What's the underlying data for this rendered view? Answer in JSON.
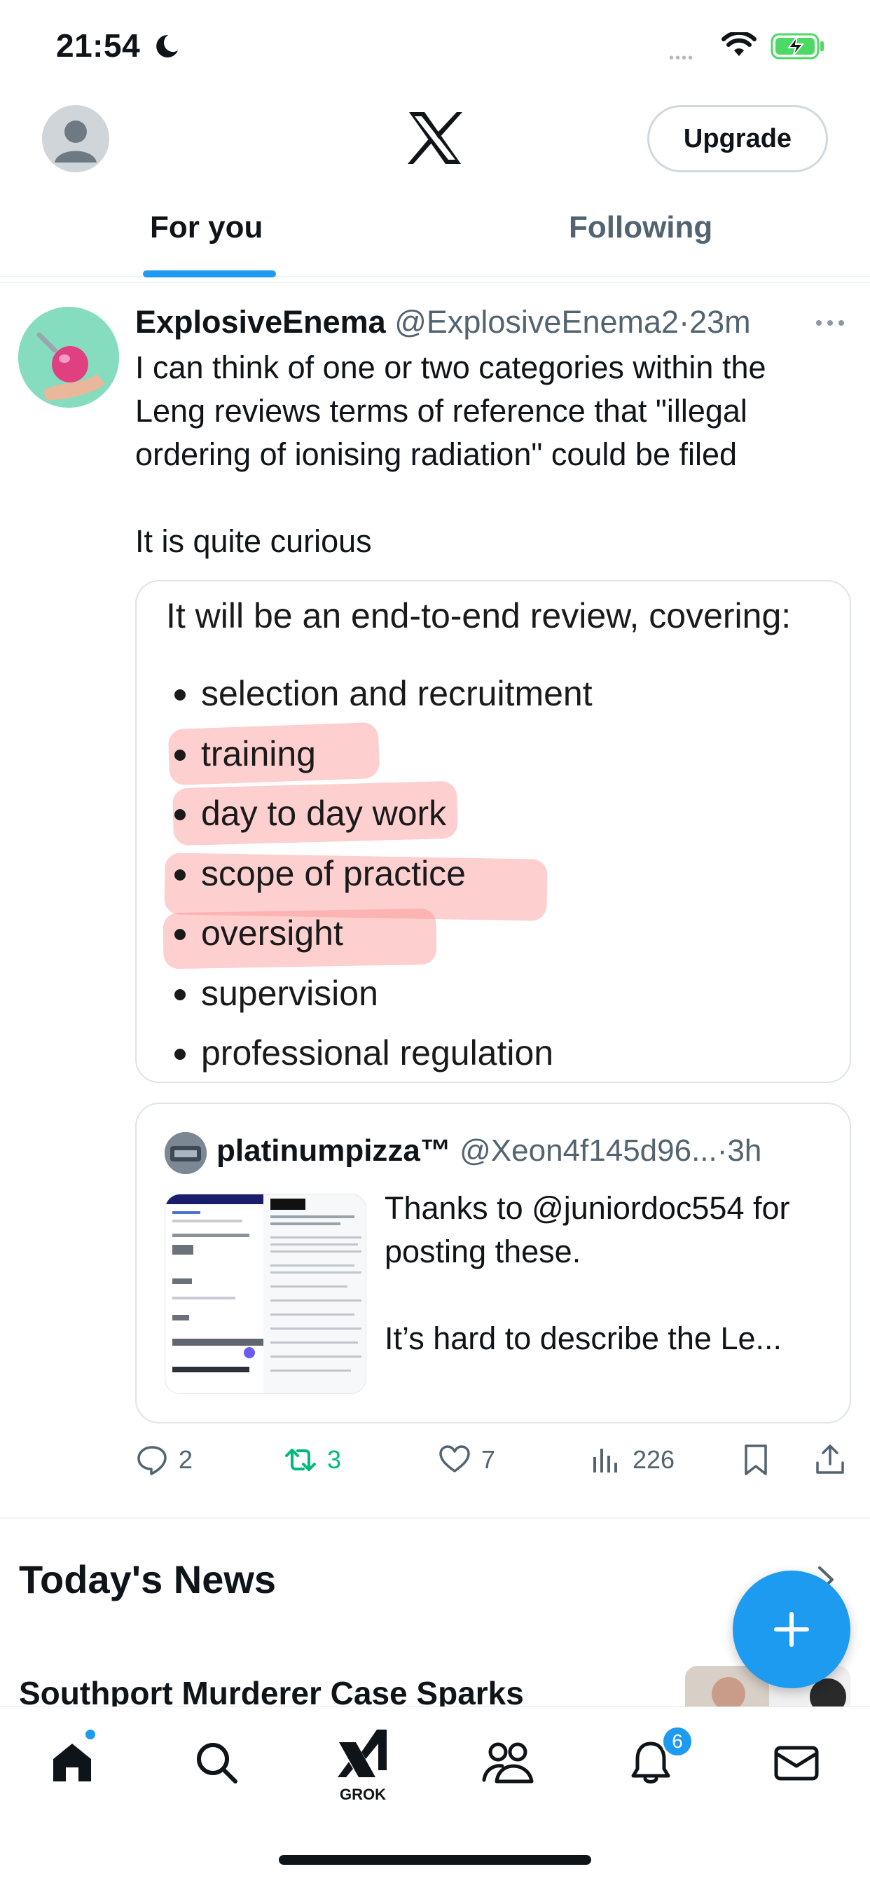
{
  "status_bar": {
    "time": "21:54",
    "signal": "•••• "
  },
  "header": {
    "upgrade_label": "Upgrade"
  },
  "tabs": [
    {
      "label": "For you",
      "selected": true
    },
    {
      "label": "Following",
      "selected": false
    }
  ],
  "tweet": {
    "author_name": "ExplosiveEnema",
    "author_handle": "@ExplosiveEnema2",
    "separator": "·",
    "time": "23m",
    "text": "I can think of one or two categories within the Leng reviews terms of reference that \"illegal ordering of ionising radiation\" could be filed\n\nIt is quite curious",
    "media": {
      "intro": "It will be an end-to-end review, covering:",
      "items": [
        "selection and recruitment",
        "training",
        "day to day work",
        "scope of practice",
        "oversight",
        "supervision",
        "professional regulation"
      ]
    },
    "quote": {
      "author_name": "platinumpizza™",
      "author_handle": "@Xeon4f145d96...",
      "separator": "·",
      "time": "3h",
      "text": "Thanks to @juniordoc554 for posting these.\n\nIt’s hard to describe the Le..."
    },
    "actions": {
      "replies": "2",
      "reposts": "3",
      "likes": "7",
      "views": "226"
    }
  },
  "news": {
    "title": "Today's News",
    "headline": "Southport Murderer Case Sparks"
  },
  "bottom_nav": {
    "grok_label": "GROK",
    "notifications_count": "6"
  },
  "colors": {
    "accent": "#1d9bf0",
    "repost_green": "#00ba7c",
    "secondary_text": "#536471"
  }
}
